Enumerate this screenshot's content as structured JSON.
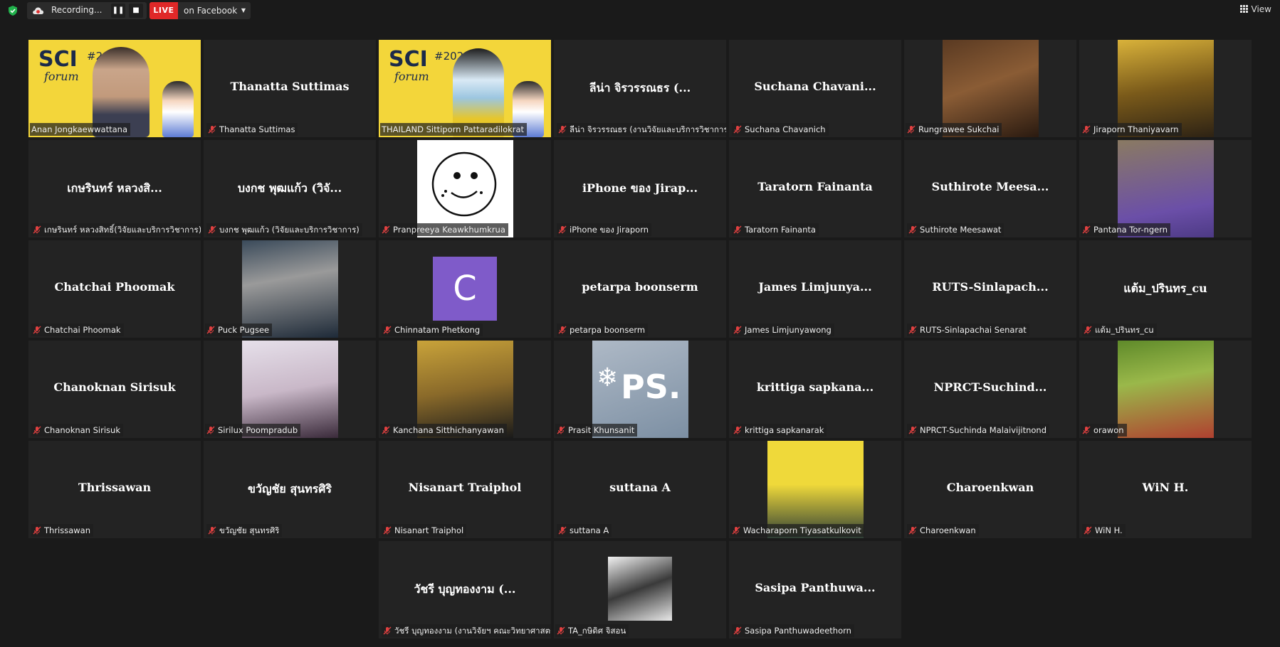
{
  "topbar": {
    "recording_label": "Recording...",
    "pause_glyph": "❚❚",
    "stop_glyph": "■",
    "live_label": "LIVE",
    "live_target": "on Facebook",
    "view_label": "View",
    "icons": {
      "security": "shield-check-icon",
      "recording": "cloud-record-icon",
      "view": "grid-view-icon"
    }
  },
  "colors": {
    "background": "#1a1a1a",
    "tile": "#232323",
    "active_speaker": "#b6e34a",
    "live": "#e02828",
    "muted_mic": "#e04040",
    "avatar_c": "#7f5bc9"
  },
  "participants": [
    {
      "display": "",
      "label": "Anan Jongkaewwattana",
      "video": true,
      "active": true,
      "muted": false
    },
    {
      "display": "Thanatta Suttimas",
      "label": "Thanatta Suttimas",
      "video": false,
      "muted": true
    },
    {
      "display": "",
      "label": "THAILAND Sittiporn Pattaradilokrat",
      "video": true,
      "muted": false
    },
    {
      "display": "ลีน่า จิรวรรณธร (...",
      "label": "ลีน่า จิรวรรณธร (งานวิจัยและบริการวิชาการ)",
      "video": false,
      "muted": true
    },
    {
      "display": "Suchana Chavani...",
      "label": "Suchana Chavanich",
      "video": false,
      "muted": true
    },
    {
      "display": "",
      "label": "Rungrawee Sukchai",
      "video": true,
      "muted": true
    },
    {
      "display": "",
      "label": "Jiraporn Thaniyavarn",
      "video": true,
      "muted": true
    },
    {
      "display": "เกษรินทร์ หลวงสิ...",
      "label": "เกษรินทร์ หลวงสิทธิ์(วิจัยและบริการวิชาการ)",
      "video": false,
      "muted": true
    },
    {
      "display": "บงกช พุฒแก้ว (วิจั...",
      "label": "บงกช พุฒแก้ว (วิจัยและบริการวิชาการ)",
      "video": false,
      "muted": true
    },
    {
      "display": "",
      "label": "Pranpreeya Keawkhumkrua",
      "video": true,
      "muted": true
    },
    {
      "display": "iPhone ของ Jirap...",
      "label": "iPhone ของ Jiraporn",
      "video": false,
      "muted": true
    },
    {
      "display": "Taratorn Fainanta",
      "label": "Taratorn Fainanta",
      "video": false,
      "muted": true
    },
    {
      "display": "Suthirote Meesa...",
      "label": "Suthirote Meesawat",
      "video": false,
      "muted": true
    },
    {
      "display": "",
      "label": "Pantana Tor-ngern",
      "video": true,
      "muted": true
    },
    {
      "display": "Chatchai Phoomak",
      "label": "Chatchai Phoomak",
      "video": false,
      "muted": true
    },
    {
      "display": "",
      "label": "Puck Pugsee",
      "video": true,
      "muted": true
    },
    {
      "display": "",
      "label": "Chinnatam Phetkong",
      "video": false,
      "avatar": "C",
      "muted": true
    },
    {
      "display": "petarpa boonserm",
      "label": "petarpa boonserm",
      "video": false,
      "muted": true
    },
    {
      "display": "James Limjunya...",
      "label": "James Limjunyawong",
      "video": false,
      "muted": true
    },
    {
      "display": "RUTS-Sinlapach...",
      "label": "RUTS-Sinlapachai Senarat",
      "video": false,
      "muted": true
    },
    {
      "display": "แต้ม_ปรินทร_cu",
      "label": "แต้ม_ปรินทร_cu",
      "video": false,
      "muted": true
    },
    {
      "display": "Chanoknan Sirisuk",
      "label": "Chanoknan Sirisuk",
      "video": false,
      "muted": true
    },
    {
      "display": "",
      "label": "Sirilux Poompradub",
      "video": true,
      "muted": true
    },
    {
      "display": "",
      "label": "Kanchana Sitthichanyawan",
      "video": true,
      "muted": true
    },
    {
      "display": "",
      "label": "Prasit Khunsanit",
      "video": true,
      "muted": true,
      "photo_text": "PS."
    },
    {
      "display": "krittiga sapkana...",
      "label": "krittiga sapkanarak",
      "video": false,
      "muted": true
    },
    {
      "display": "NPRCT-Suchind...",
      "label": "NPRCT-Suchinda Malaivijitnond",
      "video": false,
      "muted": true
    },
    {
      "display": "",
      "label": "orawon",
      "video": true,
      "muted": true
    },
    {
      "display": "Thrissawan",
      "label": "Thrissawan",
      "video": false,
      "muted": true
    },
    {
      "display": "ขวัญชัย สุนทรศิริ",
      "label": "ขวัญชัย สุนทรศิริ",
      "video": false,
      "muted": true
    },
    {
      "display": "Nisanart Traiphol",
      "label": "Nisanart Traiphol",
      "video": false,
      "muted": true
    },
    {
      "display": "suttana A",
      "label": "suttana A",
      "video": false,
      "muted": true
    },
    {
      "display": "",
      "label": "Wacharaporn Tiyasatkulkovit",
      "video": true,
      "muted": true
    },
    {
      "display": "Charoenkwan",
      "label": "Charoenkwan",
      "video": false,
      "muted": true
    },
    {
      "display": "WiN H.",
      "label": "WiN H.",
      "video": false,
      "muted": true
    },
    {
      "display": "วัชรี บุญทองงาม (...",
      "label": "วัชรี บุญทองงาม (งานวิจัยฯ คณะวิทยาศาสตร์)",
      "video": false,
      "muted": true
    },
    {
      "display": "",
      "label": "TA_กษิดิศ จิสอน",
      "video": true,
      "muted": true
    },
    {
      "display": "Sasipa Panthuwa...",
      "label": "Sasipa Panthuwadeethorn",
      "video": false,
      "muted": true
    }
  ],
  "banner_text": {
    "sci": "SCI",
    "forum": "forum",
    "year_partial_1": "#20",
    "year_partial_2": "#202"
  }
}
